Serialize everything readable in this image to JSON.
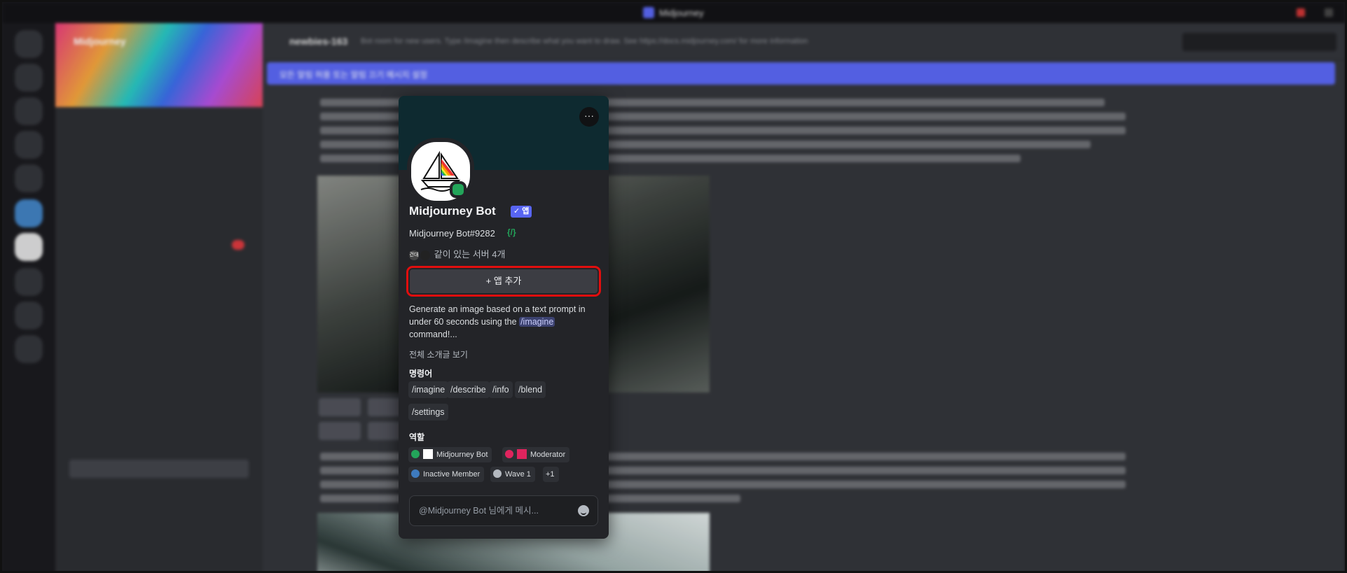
{
  "window": {
    "title": "Midjourney"
  },
  "server": {
    "name": "Midjourney"
  },
  "channel_header": {
    "name": "newbies-163",
    "description": "Bot room for new users. Type /imagine then describe what you want to draw. See https://docs.midjourney.com/ for more information"
  },
  "notice": {
    "text": "모든 알림 허용 또는 알림 끄기 메시지 설정"
  },
  "popout": {
    "more_label": "···",
    "name": "Midjourney Bot",
    "app_tag": "앱",
    "username": "Midjourney Bot#9282",
    "dev_badge": "{/}",
    "mutual_servers": "같이 있는 서버 4개",
    "mutual_icon_label": "건대",
    "add_app_label": "+ 앱 추가",
    "description_prefix": "Generate an image based on a text prompt in under 60 seconds using the ",
    "description_command": "/imagine",
    "description_suffix": " command!...",
    "full_intro_link": "전체 소개글 보기",
    "commands_title": "명령어",
    "commands": [
      "/imagine",
      "/describe",
      "/info",
      "/blend",
      "/settings"
    ],
    "roles_title": "역할",
    "roles": [
      {
        "label": "Midjourney Bot",
        "color": "#23a55a"
      },
      {
        "label": "Moderator",
        "color": "#e0245e"
      },
      {
        "label": "Inactive Member",
        "color": "#3e7bbf"
      },
      {
        "label": "Wave 1",
        "color": "#b5bac1"
      }
    ],
    "roles_more": "+1",
    "message_placeholder": "@Midjourney Bot 님에게 메시..."
  },
  "colors": {
    "accent": "#5865f2",
    "highlight_box": "#e10e0e",
    "online": "#23a55a"
  }
}
